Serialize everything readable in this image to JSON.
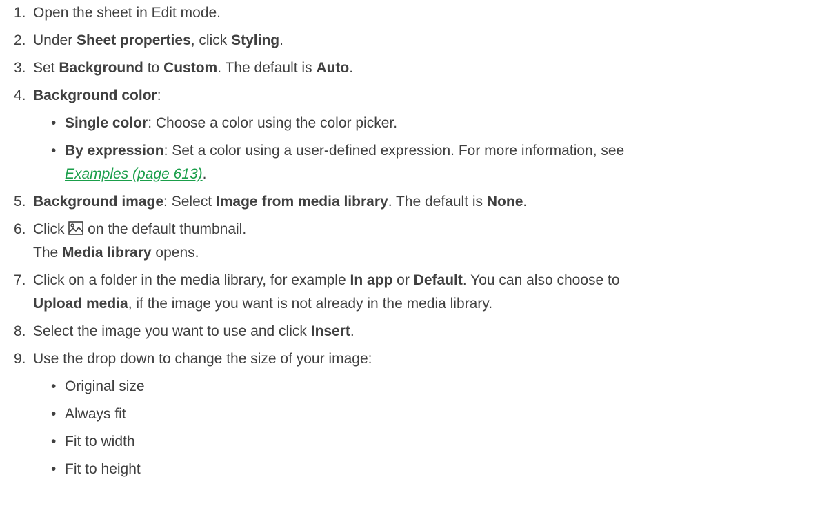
{
  "steps": [
    {
      "num": "1.",
      "t0": "Open the sheet in Edit mode."
    },
    {
      "num": "2.",
      "t0": "Under ",
      "b0": "Sheet properties",
      "t1": ", click ",
      "b1": "Styling",
      "t2": "."
    },
    {
      "num": "3.",
      "t0": "Set ",
      "b0": "Background",
      "t1": " to ",
      "b1": "Custom",
      "t2": ". The default is ",
      "b2": "Auto",
      "t3": "."
    },
    {
      "num": "4.",
      "b0": "Background color",
      "t0": ":"
    },
    {
      "num": "5.",
      "b0": "Background image",
      "t0": ": Select ",
      "b1": "Image from media library",
      "t1": ". The default is ",
      "b2": "None",
      "t2": "."
    },
    {
      "num": "6.",
      "t0": "Click ",
      "t1": " on the default thumbnail.",
      "t2": "The ",
      "b0": "Media library",
      "t3": " opens."
    },
    {
      "num": "7.",
      "t0": "Click on a folder in the media library, for example ",
      "b0": "In app",
      "t1": " or ",
      "b1": "Default",
      "t2": ". You can also choose to",
      "b2": "Upload media",
      "t3": ", if the image you want is not already in the media library."
    },
    {
      "num": "8.",
      "t0": "Select the image you want to use and click ",
      "b0": "Insert",
      "t1": "."
    },
    {
      "num": "9.",
      "t0": "Use the drop down to change the size of your image:"
    }
  ],
  "color_options": [
    {
      "b0": "Single color",
      "t0": ": Choose a color using the color picker."
    },
    {
      "b0": "By expression",
      "t0": ": Set a color using a user-defined expression. For more information, see",
      "link": "Examples (page 613)",
      "t1": "."
    }
  ],
  "size_options": [
    "Original size",
    "Always fit",
    "Fit to width",
    "Fit to height"
  ],
  "bullet_char": "•",
  "icons": {
    "image_icon": "image-icon"
  },
  "colors": {
    "text": "#404040",
    "link": "#1a9e4a"
  }
}
